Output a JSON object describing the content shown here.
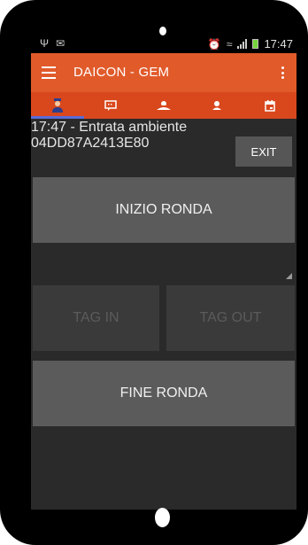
{
  "status_bar": {
    "time": "17:47",
    "left_icons": [
      "usb-icon",
      "mail-icon"
    ],
    "right_icons": [
      "alarm-icon",
      "wifi-icon",
      "signal-icon",
      "battery-icon"
    ],
    "battery_color": "#74d33b"
  },
  "action_bar": {
    "title": "DAICON - GEM",
    "color": "#e15a2a"
  },
  "tabs": [
    {
      "icon": "guard-icon",
      "active": true
    },
    {
      "icon": "chat-icon",
      "active": false
    },
    {
      "icon": "patrol-icon",
      "active": false
    },
    {
      "icon": "person-icon",
      "active": false
    },
    {
      "icon": "calendar-icon",
      "active": false
    }
  ],
  "info": {
    "line1": "17:47 - Entrata ambiente",
    "line2": "04DD87A2413E80"
  },
  "buttons": {
    "exit": "EXIT",
    "start_round": "INIZIO RONDA",
    "tag_in": "TAG IN",
    "tag_out": "TAG OUT",
    "end_round": "FINE RONDA"
  },
  "input": {
    "value": ""
  }
}
